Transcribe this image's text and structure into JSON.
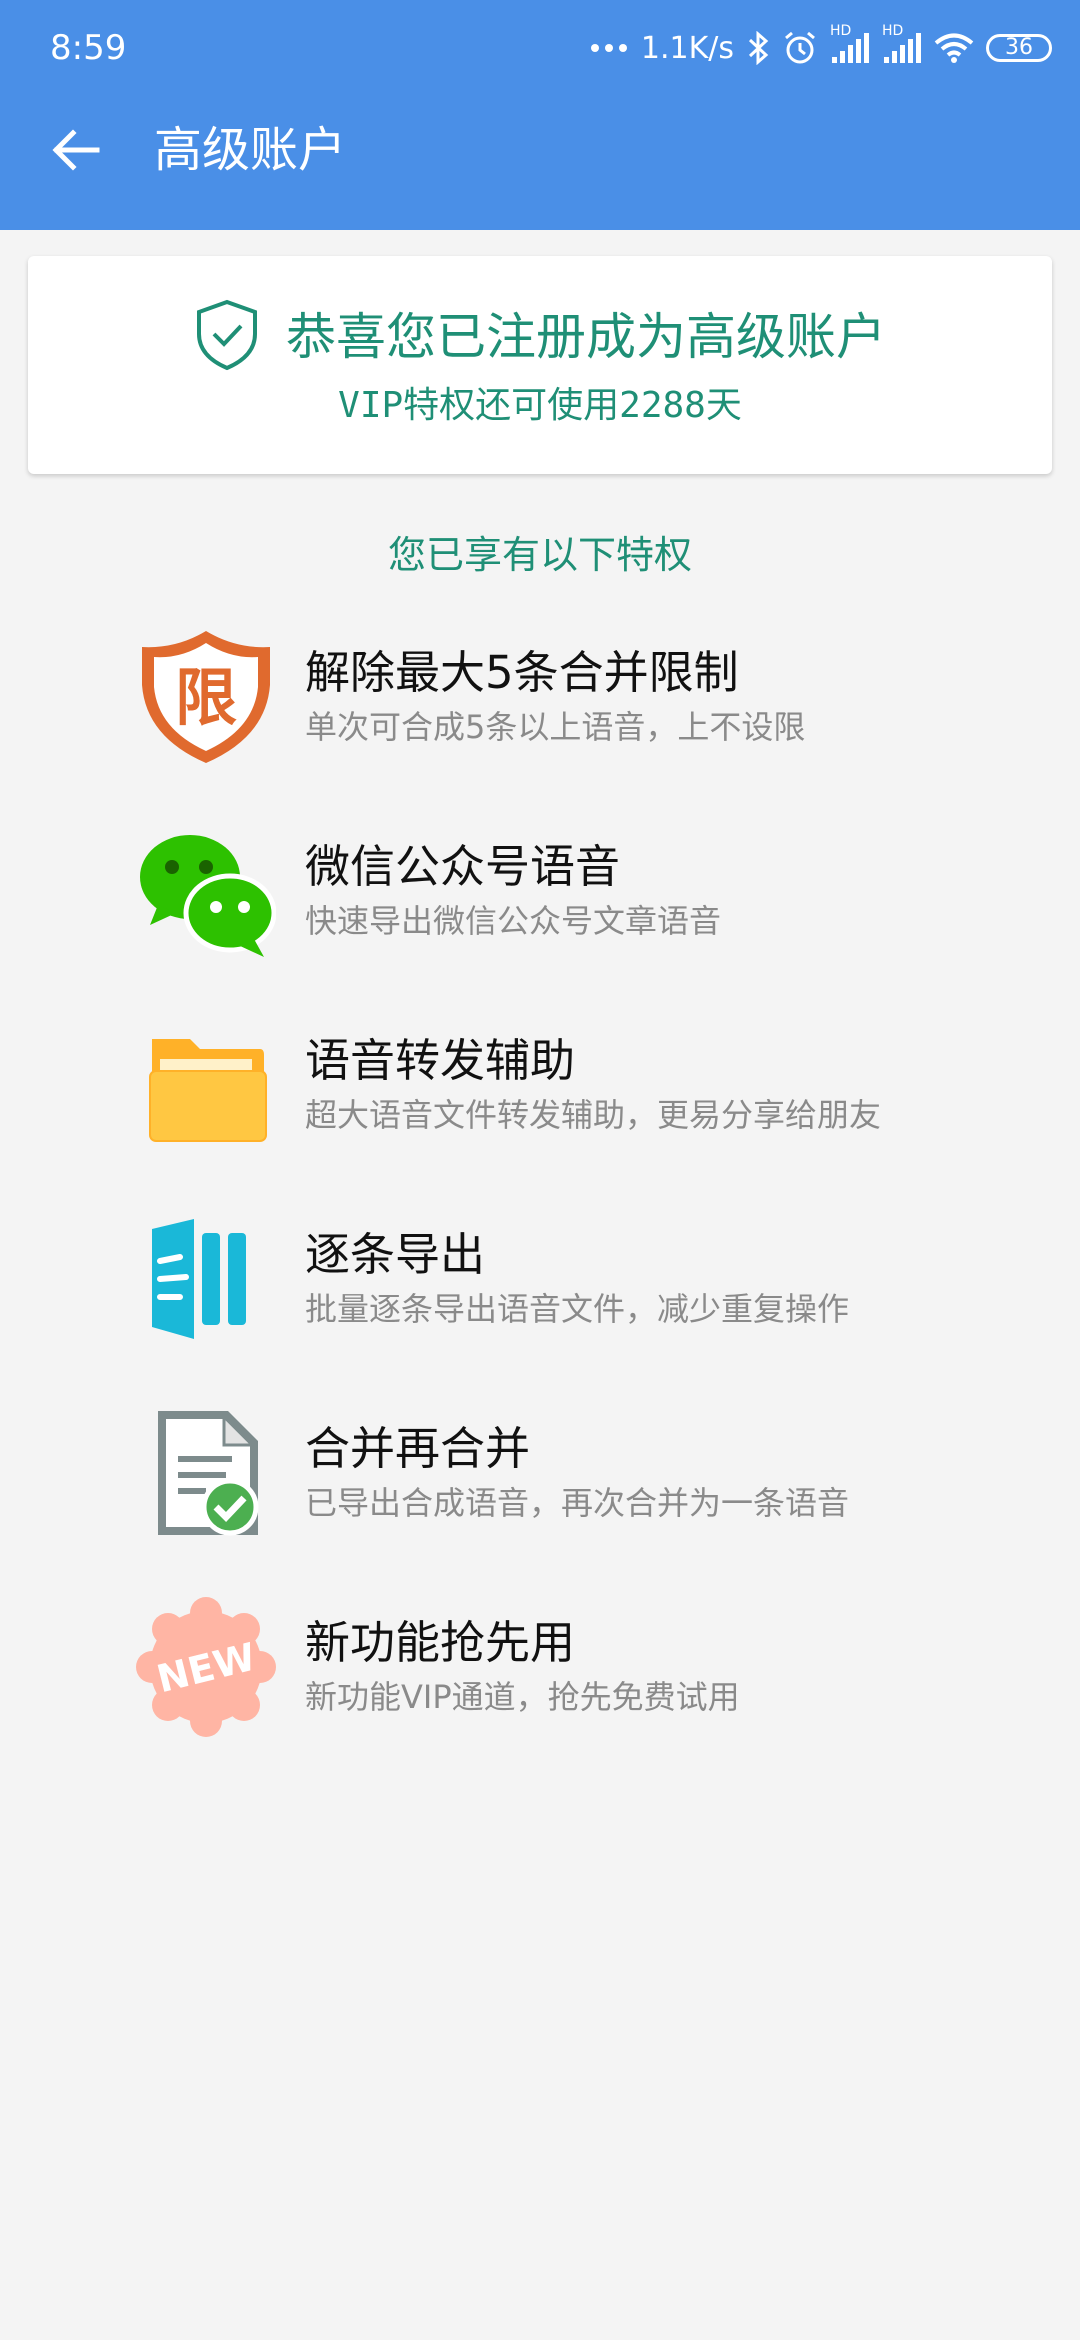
{
  "status_bar": {
    "time": "8:59",
    "network_speed": "1.1K/s",
    "hd_label_1": "HD",
    "hd_label_2": "HD",
    "battery": "36",
    "icons": [
      "dots-icon",
      "bluetooth-icon",
      "alarm-icon",
      "signal-icon",
      "signal-icon",
      "wifi-icon",
      "battery-icon"
    ]
  },
  "app_bar": {
    "title": "高级账户",
    "back_icon": "arrow-left-icon"
  },
  "vip_card": {
    "headline": "恭喜您已注册成为高级账户",
    "subline": "VIP特权还可使用2288天",
    "icon": "shield-check-icon"
  },
  "section_title": "您已享有以下特权",
  "features": [
    {
      "icon": "limit-shield-icon",
      "icon_text": "限",
      "title": "解除最大5条合并限制",
      "desc": "单次可合成5条以上语音，上不设限"
    },
    {
      "icon": "wechat-icon",
      "title": "微信公众号语音",
      "desc": "快速导出微信公众号文章语音"
    },
    {
      "icon": "folder-icon",
      "title": "语音转发辅助",
      "desc": "超大语音文件转发辅助，更易分享给朋友"
    },
    {
      "icon": "export-bars-icon",
      "title": "逐条导出",
      "desc": "批量逐条导出语音文件，减少重复操作"
    },
    {
      "icon": "document-check-icon",
      "title": "合并再合并",
      "desc": "已导出合成语音，再次合并为一条语音"
    },
    {
      "icon": "new-badge-icon",
      "icon_text": "NEW",
      "title": "新功能抢先用",
      "desc": "新功能VIP通道，抢先免费试用"
    }
  ],
  "colors": {
    "header_blue": "#4a8fe7",
    "teal_text": "#1f8f76",
    "background": "#f4f4f4",
    "limit_orange": "#e06a2e",
    "wechat_green": "#2dc100",
    "folder_yellow": "#ffb128",
    "export_blue": "#1ab8d8",
    "doc_gray": "#7d8b8c",
    "check_green": "#4caf50",
    "new_pink": "#ffb5a4"
  }
}
